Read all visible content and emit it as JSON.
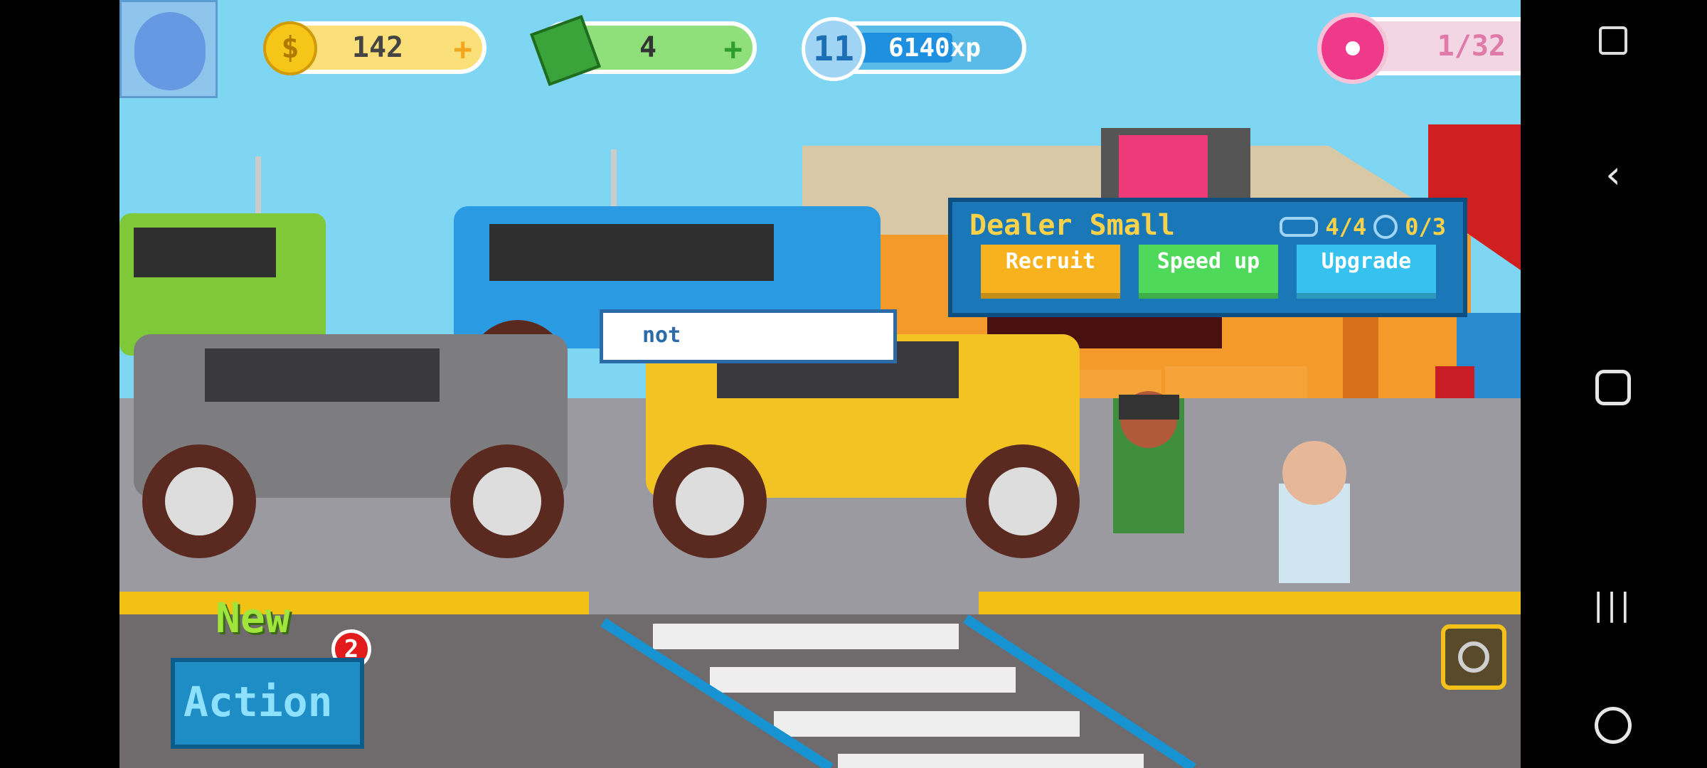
{
  "hud": {
    "coins": "142",
    "cash": "4",
    "level": "11",
    "xp": "6140xp",
    "donuts": "1/32",
    "xp_progress": 0.45,
    "plus": "+"
  },
  "dealer_popup": {
    "title": "Dealer Small",
    "cars": "4/4",
    "staff": "0/3",
    "recruit_label": "Recruit",
    "speedup_label": "Speed up",
    "upgrade_label": "Upgrade"
  },
  "speech_bubble": "not",
  "action": {
    "new_label": "New",
    "button_label": "Action",
    "badge_count": "2"
  },
  "colors": {
    "sky": "#7fd6f3",
    "coin_pill": "#fbe07a",
    "cash_pill": "#8fe07a",
    "xp_pill": "#6fc8f0",
    "donut_pill": "#f3d6e4",
    "recruit": "#f7b21e",
    "speedup": "#4fd95b",
    "upgrade": "#36c1ee",
    "action": "#1e8dc6"
  },
  "icons": [
    "avatar-icon",
    "coin-icon",
    "cash-icon",
    "level-badge-icon",
    "donut-icon",
    "car-icon",
    "people-icon",
    "wrench-icon",
    "screenshot-icon",
    "back-icon",
    "home-icon",
    "recents-icon",
    "game-controller-icon"
  ]
}
